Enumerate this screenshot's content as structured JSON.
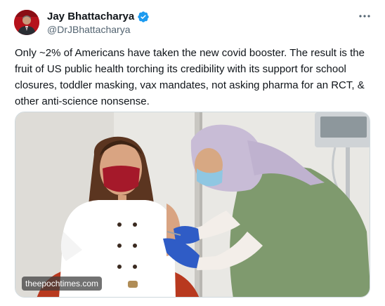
{
  "author": {
    "display_name": "Jay Bhattacharya",
    "handle": "@DrJBhattacharya",
    "verified": true
  },
  "tweet": {
    "text": "Only ~2% of Americans have taken the new covid booster. The result is the fruit of US public health torching its credibility with its support for school closures, toddler masking, vax mandates, not asking pharma for an RCT, & other anti-science nonsense."
  },
  "media": {
    "source_label": "theepochtimes.com"
  },
  "icons": {
    "verified": "verified-badge-icon",
    "more": "more-options-icon"
  },
  "colors": {
    "verified_blue": "#1d9bf0",
    "handle_gray": "#536471",
    "text": "#0f1419"
  }
}
